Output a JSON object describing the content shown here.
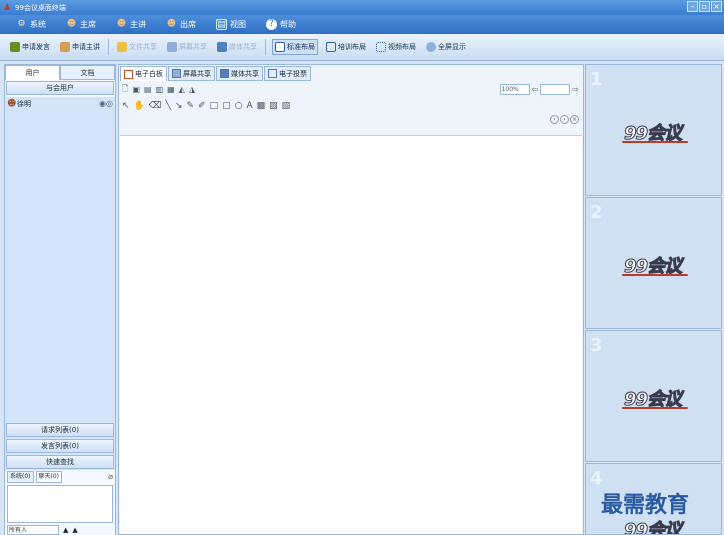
{
  "window": {
    "title": "99会议桌面终端"
  },
  "menu": [
    {
      "label": "系统",
      "icon": "gear-icon"
    },
    {
      "label": "主席",
      "icon": "user-icon"
    },
    {
      "label": "主讲",
      "icon": "user-icon"
    },
    {
      "label": "出席",
      "icon": "user-icon"
    },
    {
      "label": "视图",
      "icon": "view-icon"
    },
    {
      "label": "帮助",
      "icon": "help-icon"
    }
  ],
  "toolbar": {
    "apply_speak": "申请发言",
    "apply_lecture": "申请主讲",
    "file_share": "文件共享",
    "screen_share": "屏幕共享",
    "media_share": "媒体共享",
    "standard_layout": "标准布局",
    "training_layout": "培训布局",
    "video_layout": "视频布局",
    "fullscreen": "全屏显示"
  },
  "left_panel": {
    "tabs": [
      "用户",
      "文档"
    ],
    "header": "与会用户",
    "users": [
      {
        "name": "徐明"
      }
    ],
    "request_list": "请求列表(0)",
    "speak_list": "发言列表(0)",
    "quick_search": "快速查找",
    "chat_tabs": [
      "系统(0)",
      "聊天(0)"
    ],
    "chat_target": "所有人"
  },
  "center": {
    "tabs": [
      "电子白板",
      "屏幕共享",
      "媒体共享",
      "电子投票"
    ],
    "zoom": "100%"
  },
  "video_panels": [
    {
      "num": "1",
      "logo": "99会议"
    },
    {
      "num": "2",
      "logo": "99会议"
    },
    {
      "num": "3",
      "logo": "99会议"
    },
    {
      "num": "4",
      "logo": "99会议"
    }
  ],
  "watermark": "最需教育",
  "colors": {
    "accent": "#3a7dd0",
    "panel": "#cfe0f3"
  }
}
